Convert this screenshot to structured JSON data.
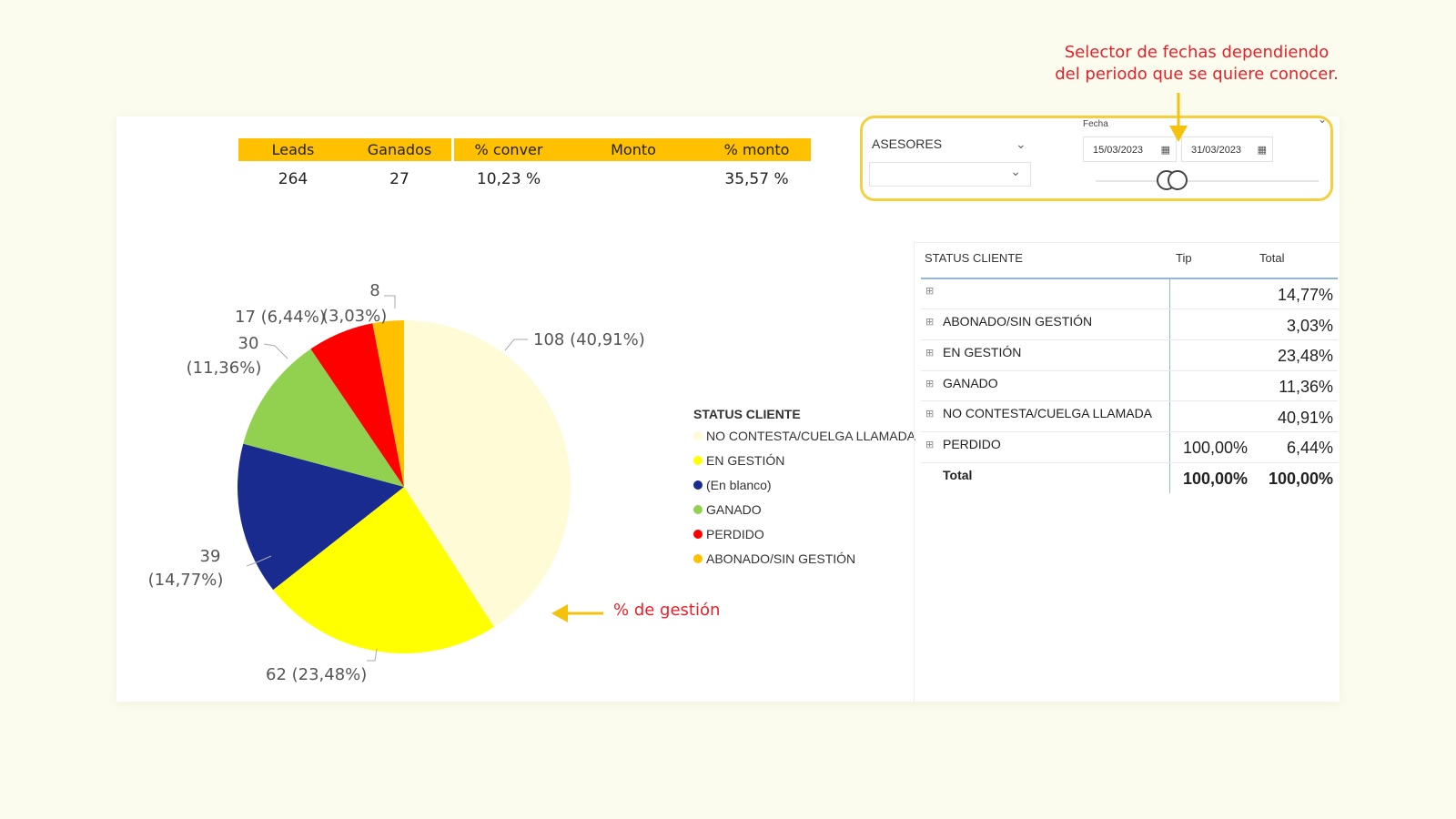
{
  "annotations": {
    "top_line1": "Selector de fechas dependiendo",
    "top_line2": "del periodo que se quiere conocer.",
    "gestion": "% de gestión"
  },
  "kpis": {
    "headers": [
      "Leads",
      "Ganados",
      "% conver",
      "Monto",
      "% monto"
    ],
    "values": [
      "264",
      "27",
      "10,23 %",
      "",
      "35,57 %"
    ]
  },
  "filters": {
    "asesores_label": "ASESORES",
    "fecha_label": "Fecha",
    "start_date": "15/03/2023",
    "end_date": "31/03/2023"
  },
  "legend": {
    "title": "STATUS CLIENTE",
    "items": [
      {
        "label": "NO CONTESTA/CUELGA LLAMADA",
        "color": "#fffbd6"
      },
      {
        "label": "EN GESTIÓN",
        "color": "#ffff00"
      },
      {
        "label": "(En blanco)",
        "color": "#1a2b8f"
      },
      {
        "label": "GANADO",
        "color": "#92d050"
      },
      {
        "label": "PERDIDO",
        "color": "#ff0000"
      },
      {
        "label": "ABONADO/SIN GESTIÓN",
        "color": "#ffc000"
      }
    ]
  },
  "table": {
    "headers": [
      "STATUS CLIENTE",
      "Tip",
      "Total"
    ],
    "rows": [
      {
        "label": "",
        "tip": "",
        "total": "14,77%"
      },
      {
        "label": "ABONADO/SIN GESTIÓN",
        "tip": "",
        "total": "3,03%"
      },
      {
        "label": "EN GESTIÓN",
        "tip": "",
        "total": "23,48%"
      },
      {
        "label": "GANADO",
        "tip": "",
        "total": "11,36%"
      },
      {
        "label": "NO CONTESTA/CUELGA LLAMADA",
        "tip": "",
        "total": "40,91%"
      },
      {
        "label": "PERDIDO",
        "tip": "100,00%",
        "total": "6,44%"
      }
    ],
    "total_label": "Total",
    "total_tip": "100,00%",
    "total_total": "100,00%"
  },
  "chart_data": {
    "type": "pie",
    "series": [
      {
        "category": "NO CONTESTA/CUELGA LLAMADA",
        "value": 108,
        "percent": 40.91,
        "label": "108 (40,91%)",
        "color": "#fffbd6"
      },
      {
        "category": "EN GESTIÓN",
        "value": 62,
        "percent": 23.48,
        "label": "62 (23,48%)",
        "color": "#ffff00"
      },
      {
        "category": "(En blanco)",
        "value": 39,
        "percent": 14.77,
        "label_line1": "39",
        "label_line2": "(14,77%)",
        "color": "#1a2b8f"
      },
      {
        "category": "GANADO",
        "value": 30,
        "percent": 11.36,
        "label_line1": "30",
        "label_line2": "(11,36%)",
        "color": "#92d050"
      },
      {
        "category": "PERDIDO",
        "value": 17,
        "percent": 6.44,
        "label": "17 (6,44%)",
        "color": "#ff0000"
      },
      {
        "category": "ABONADO/SIN GESTIÓN",
        "value": 8,
        "percent": 3.03,
        "label_line1": "8",
        "label_line2": "(3,03%)",
        "color": "#ffc000"
      }
    ]
  }
}
